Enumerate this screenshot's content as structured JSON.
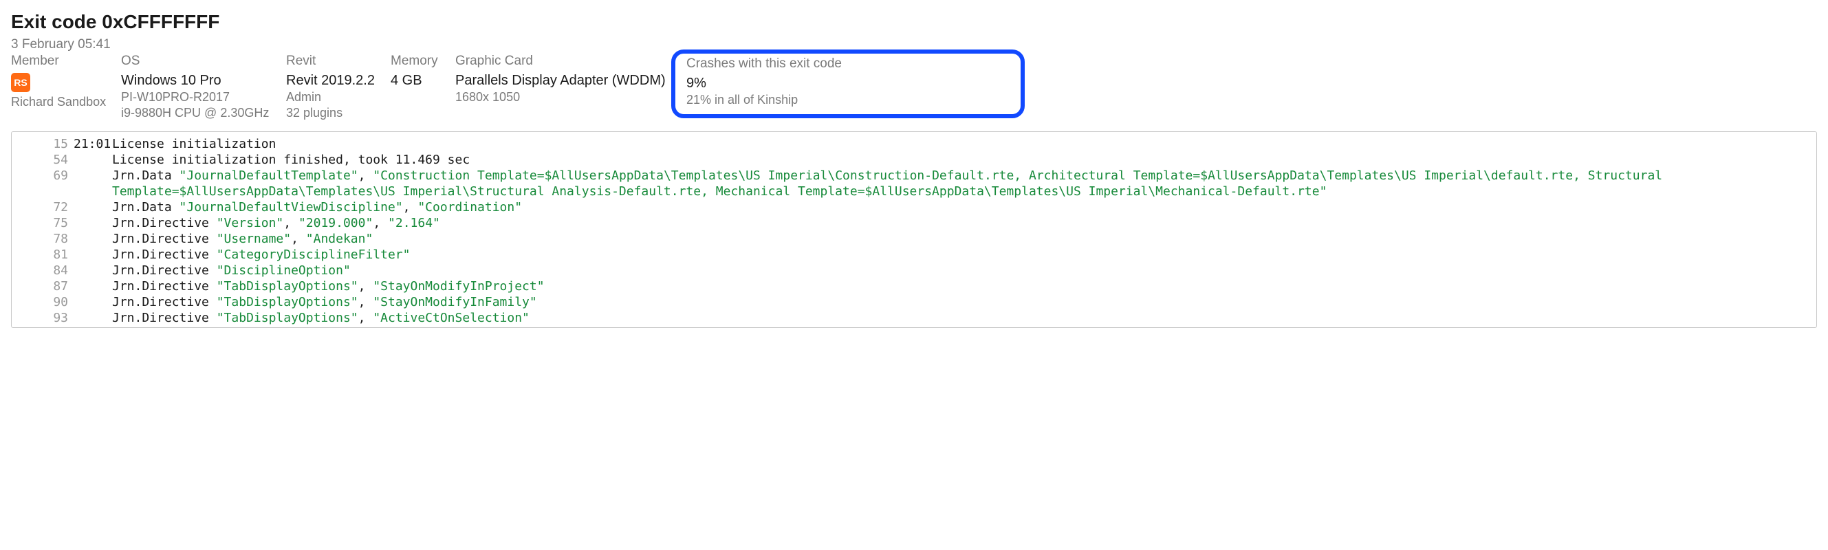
{
  "title": "Exit code 0xCFFFFFFF",
  "timestamp": "3 February 05:41",
  "columns": {
    "member": {
      "label": "Member",
      "avatar_initials": "RS",
      "name": "Richard Sandbox"
    },
    "os": {
      "label": "OS",
      "value": "Windows 10 Pro",
      "sub1": "PI-W10PRO-R2017",
      "sub2": "i9-9880H CPU @ 2.30GHz"
    },
    "revit": {
      "label": "Revit",
      "value": "Revit 2019.2.2",
      "sub1": "Admin",
      "sub2": "32 plugins"
    },
    "memory": {
      "label": "Memory",
      "value": "4 GB"
    },
    "gpu": {
      "label": "Graphic Card",
      "value": "Parallels Display Adapter (WDDM)",
      "sub1": "1680x 1050"
    },
    "crashes": {
      "label": "Crashes with this exit code",
      "value": "9%",
      "sub1": "21% in all of Kinship"
    }
  },
  "log": [
    {
      "ln": "15",
      "ts": "21:01",
      "tokens": [
        {
          "t": "plain",
          "v": "License initialization"
        }
      ]
    },
    {
      "ln": "54",
      "ts": "",
      "tokens": [
        {
          "t": "plain",
          "v": "License initialization finished, took 11.469 sec"
        }
      ]
    },
    {
      "ln": "69",
      "ts": "",
      "tokens": [
        {
          "t": "plain",
          "v": "Jrn.Data "
        },
        {
          "t": "str",
          "v": "\"JournalDefaultTemplate\""
        },
        {
          "t": "plain",
          "v": ", "
        },
        {
          "t": "str",
          "v": "\"Construction Template=$AllUsersAppData\\Templates\\US Imperial\\Construction-Default.rte, Architectural Template=$AllUsersAppData\\Templates\\US Imperial\\default.rte, Structural Template=$AllUsersAppData\\Templates\\US Imperial\\Structural Analysis-Default.rte, Mechanical Template=$AllUsersAppData\\Templates\\US Imperial\\Mechanical-Default.rte\""
        }
      ]
    },
    {
      "ln": "72",
      "ts": "",
      "tokens": [
        {
          "t": "plain",
          "v": "Jrn.Data "
        },
        {
          "t": "str",
          "v": "\"JournalDefaultViewDiscipline\""
        },
        {
          "t": "plain",
          "v": ", "
        },
        {
          "t": "str",
          "v": "\"Coordination\""
        }
      ]
    },
    {
      "ln": "75",
      "ts": "",
      "tokens": [
        {
          "t": "plain",
          "v": "Jrn.Directive "
        },
        {
          "t": "str",
          "v": "\"Version\""
        },
        {
          "t": "plain",
          "v": ", "
        },
        {
          "t": "str",
          "v": "\"2019.000\""
        },
        {
          "t": "plain",
          "v": ", "
        },
        {
          "t": "str",
          "v": "\"2.164\""
        }
      ]
    },
    {
      "ln": "78",
      "ts": "",
      "tokens": [
        {
          "t": "plain",
          "v": "Jrn.Directive "
        },
        {
          "t": "str",
          "v": "\"Username\""
        },
        {
          "t": "plain",
          "v": ", "
        },
        {
          "t": "str",
          "v": "\"Andekan\""
        }
      ]
    },
    {
      "ln": "81",
      "ts": "",
      "tokens": [
        {
          "t": "plain",
          "v": "Jrn.Directive "
        },
        {
          "t": "str",
          "v": "\"CategoryDisciplineFilter\""
        }
      ]
    },
    {
      "ln": "84",
      "ts": "",
      "tokens": [
        {
          "t": "plain",
          "v": "Jrn.Directive "
        },
        {
          "t": "str",
          "v": "\"DisciplineOption\""
        }
      ]
    },
    {
      "ln": "87",
      "ts": "",
      "tokens": [
        {
          "t": "plain",
          "v": "Jrn.Directive "
        },
        {
          "t": "str",
          "v": "\"TabDisplayOptions\""
        },
        {
          "t": "plain",
          "v": ", "
        },
        {
          "t": "str",
          "v": "\"StayOnModifyInProject\""
        }
      ]
    },
    {
      "ln": "90",
      "ts": "",
      "tokens": [
        {
          "t": "plain",
          "v": "Jrn.Directive "
        },
        {
          "t": "str",
          "v": "\"TabDisplayOptions\""
        },
        {
          "t": "plain",
          "v": ", "
        },
        {
          "t": "str",
          "v": "\"StayOnModifyInFamily\""
        }
      ]
    },
    {
      "ln": "93",
      "ts": "",
      "tokens": [
        {
          "t": "plain",
          "v": "Jrn.Directive "
        },
        {
          "t": "str",
          "v": "\"TabDisplayOptions\""
        },
        {
          "t": "plain",
          "v": ", "
        },
        {
          "t": "str",
          "v": "\"ActiveCtOnSelection\""
        }
      ]
    }
  ]
}
